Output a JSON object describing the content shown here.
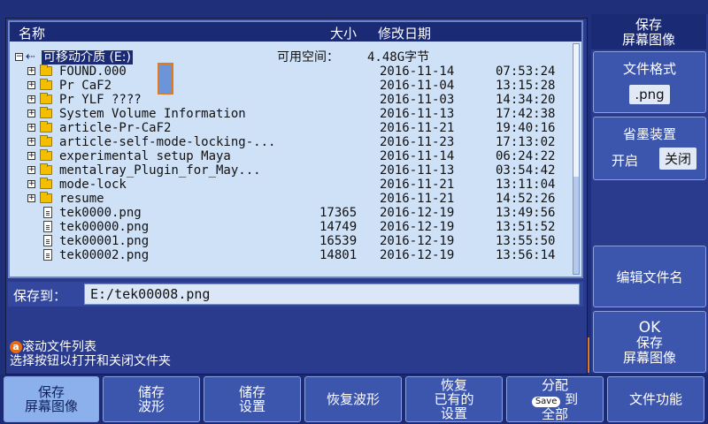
{
  "browser": {
    "col_name": "名称",
    "col_size": "大小",
    "col_date": "修改日期",
    "drive_label": "可移动介质 (E:)",
    "free_space_label": "可用空间：",
    "free_space_value": "4.48G字节",
    "rows": [
      {
        "name": "FOUND.000",
        "size": "",
        "date": "2016-11-14",
        "time": "07:53:24",
        "type": "folder"
      },
      {
        "name": "Pr CaF2",
        "size": "",
        "date": "2016-11-04",
        "time": "13:15:28",
        "type": "folder"
      },
      {
        "name": "Pr YLF ????",
        "size": "",
        "date": "2016-11-03",
        "time": "14:34:20",
        "type": "folder"
      },
      {
        "name": "System Volume Information",
        "size": "",
        "date": "2016-11-13",
        "time": "17:42:38",
        "type": "folder"
      },
      {
        "name": "article-Pr-CaF2",
        "size": "",
        "date": "2016-11-21",
        "time": "19:40:16",
        "type": "folder"
      },
      {
        "name": "article-self-mode-locking-...",
        "size": "",
        "date": "2016-11-23",
        "time": "17:13:02",
        "type": "folder"
      },
      {
        "name": "experimental setup Maya",
        "size": "",
        "date": "2016-11-14",
        "time": "06:24:22",
        "type": "folder"
      },
      {
        "name": "mentalray_Plugin_for_May...",
        "size": "",
        "date": "2016-11-13",
        "time": "03:54:42",
        "type": "folder"
      },
      {
        "name": "mode-lock",
        "size": "",
        "date": "2016-11-21",
        "time": "13:11:04",
        "type": "folder"
      },
      {
        "name": "resume",
        "size": "",
        "date": "2016-11-21",
        "time": "14:52:26",
        "type": "folder"
      },
      {
        "name": "tek0000.png",
        "size": "17365",
        "date": "2016-12-19",
        "time": "13:49:56",
        "type": "file"
      },
      {
        "name": "tek00000.png",
        "size": "14749",
        "date": "2016-12-19",
        "time": "13:51:52",
        "type": "file"
      },
      {
        "name": "tek00001.png",
        "size": "16539",
        "date": "2016-12-19",
        "time": "13:55:50",
        "type": "file"
      },
      {
        "name": "tek00002.png",
        "size": "14801",
        "date": "2016-12-19",
        "time": "13:56:14",
        "type": "file"
      }
    ]
  },
  "save_to": {
    "label": "保存到：",
    "value": "E:/tek00008.png"
  },
  "hint": {
    "badge": "a",
    "line1": "滚动文件列表",
    "line2": "选择按钮以打开和关闭文件夹"
  },
  "side": {
    "title_line1": "保存",
    "title_line2": "屏幕图像",
    "format_label": "文件格式",
    "format_value": ".png",
    "ink_label": "省墨装置",
    "ink_on": "开启",
    "ink_off": "关闭",
    "rename_label": "编辑文件名",
    "ok_line1": "OK",
    "ok_line2": "保存",
    "ok_line3": "屏幕图像"
  },
  "bottom": {
    "b1_l1": "保存",
    "b1_l2": "屏幕图像",
    "b2_l1": "储存",
    "b2_l2": "波形",
    "b3_l1": "储存",
    "b3_l2": "设置",
    "b4": "恢复波形",
    "b5_l1": "恢复",
    "b5_l2": "已有的",
    "b5_l3": "设置",
    "b6_l1": "分配",
    "b6_chip": "Save",
    "b6_to": "到",
    "b6_l3": "全部",
    "b7": "文件功能"
  },
  "colors": {
    "accent": "#e07a1a",
    "panel": "#3c55ad",
    "background": "#1f2f7a"
  }
}
